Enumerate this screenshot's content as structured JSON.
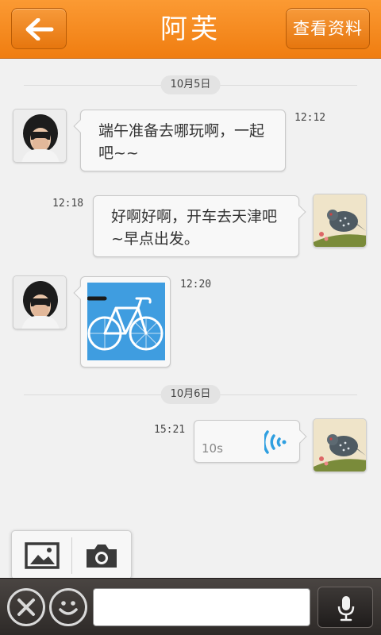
{
  "header": {
    "title": "阿芙",
    "profile_label": "查看资料"
  },
  "dates": [
    "10月5日",
    "10月6日"
  ],
  "messages": [
    {
      "side": "left",
      "time": "12:12",
      "text": "端午准备去哪玩啊，一起吧~~"
    },
    {
      "side": "right",
      "time": "12:18",
      "text": "好啊好啊，开车去天津吧~早点出发。"
    },
    {
      "side": "left",
      "time": "12:20",
      "image": "bicycle-image"
    },
    {
      "side": "right",
      "time": "15:21",
      "voice_duration": "10s"
    }
  ],
  "colors": {
    "header_orange": "#f38a20",
    "voice_blue": "#2f9fe0",
    "image_bg": "#3f9de0"
  },
  "icons": {
    "back": "arrow-left-icon",
    "gallery": "image-icon",
    "camera": "camera-icon",
    "close": "close-icon",
    "emoji": "smiley-icon",
    "mic": "microphone-icon",
    "voice": "voice-wave-icon"
  },
  "composer": {
    "value": "",
    "placeholder": ""
  }
}
